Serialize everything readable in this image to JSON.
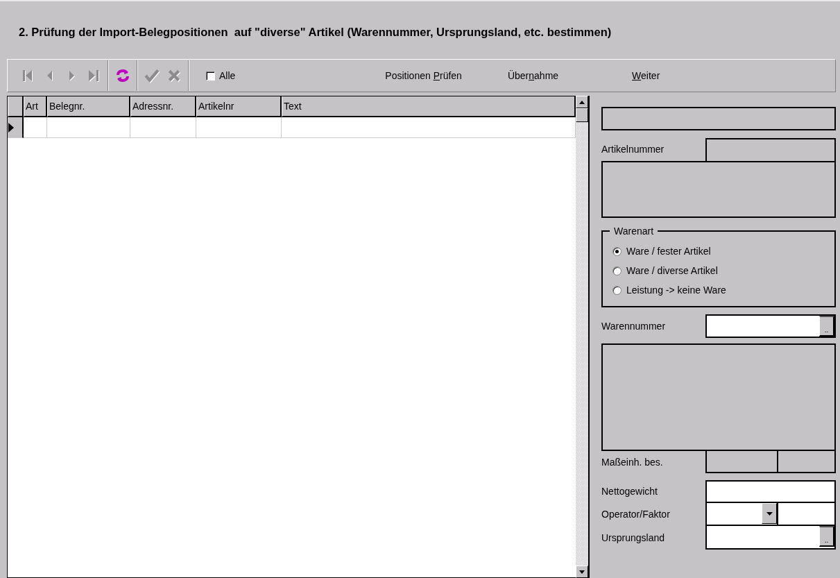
{
  "title": "2. Prüfung der Import-Belegpositionen  auf \"diverse\" Artikel (Warennummer, Ursprungsland, etc. bestimmen)",
  "toolbar": {
    "nav_buttons": [
      {
        "kind": "first",
        "disabled": true
      },
      {
        "kind": "prev",
        "disabled": true
      },
      {
        "kind": "next",
        "disabled": true
      },
      {
        "kind": "last",
        "disabled": true
      }
    ],
    "refresh": {
      "disabled": false
    },
    "edit_buttons": [
      {
        "kind": "confirm",
        "disabled": true
      },
      {
        "kind": "cancel",
        "disabled": true
      }
    ],
    "all_checkbox": {
      "label": "Alle",
      "checked": false
    },
    "actions": [
      {
        "before": "Positionen ",
        "accel": "P",
        "after": "rüfen"
      },
      {
        "before": "Über",
        "accel": "n",
        "after": "ahme"
      },
      {
        "accel": "W",
        "after": "eiter"
      }
    ]
  },
  "grid": {
    "columns": [
      "Art",
      "Belegnr.",
      "Adressnr.",
      "Artikelnr",
      "Text"
    ],
    "rows": [
      {
        "current": true
      }
    ]
  },
  "panel": {
    "artikelnummer_label": "Artikelnummer",
    "warenart": {
      "legend": "Warenart",
      "options": [
        {
          "label": "Ware / fester Artikel",
          "selected": true
        },
        {
          "label": "Ware / diverse Artikel",
          "selected": false
        },
        {
          "label": "Leistung -> keine Ware",
          "selected": false
        }
      ]
    },
    "warennummer_label": "Warennummer",
    "warennummer_button": "..",
    "masseinheit_label": "Maßeinh. bes.",
    "nettogewicht_label": "Nettogewicht",
    "operator_label": "Operator/Faktor",
    "ursprungsland_label": "Ursprungsland",
    "ursprungsland_button": ".."
  }
}
